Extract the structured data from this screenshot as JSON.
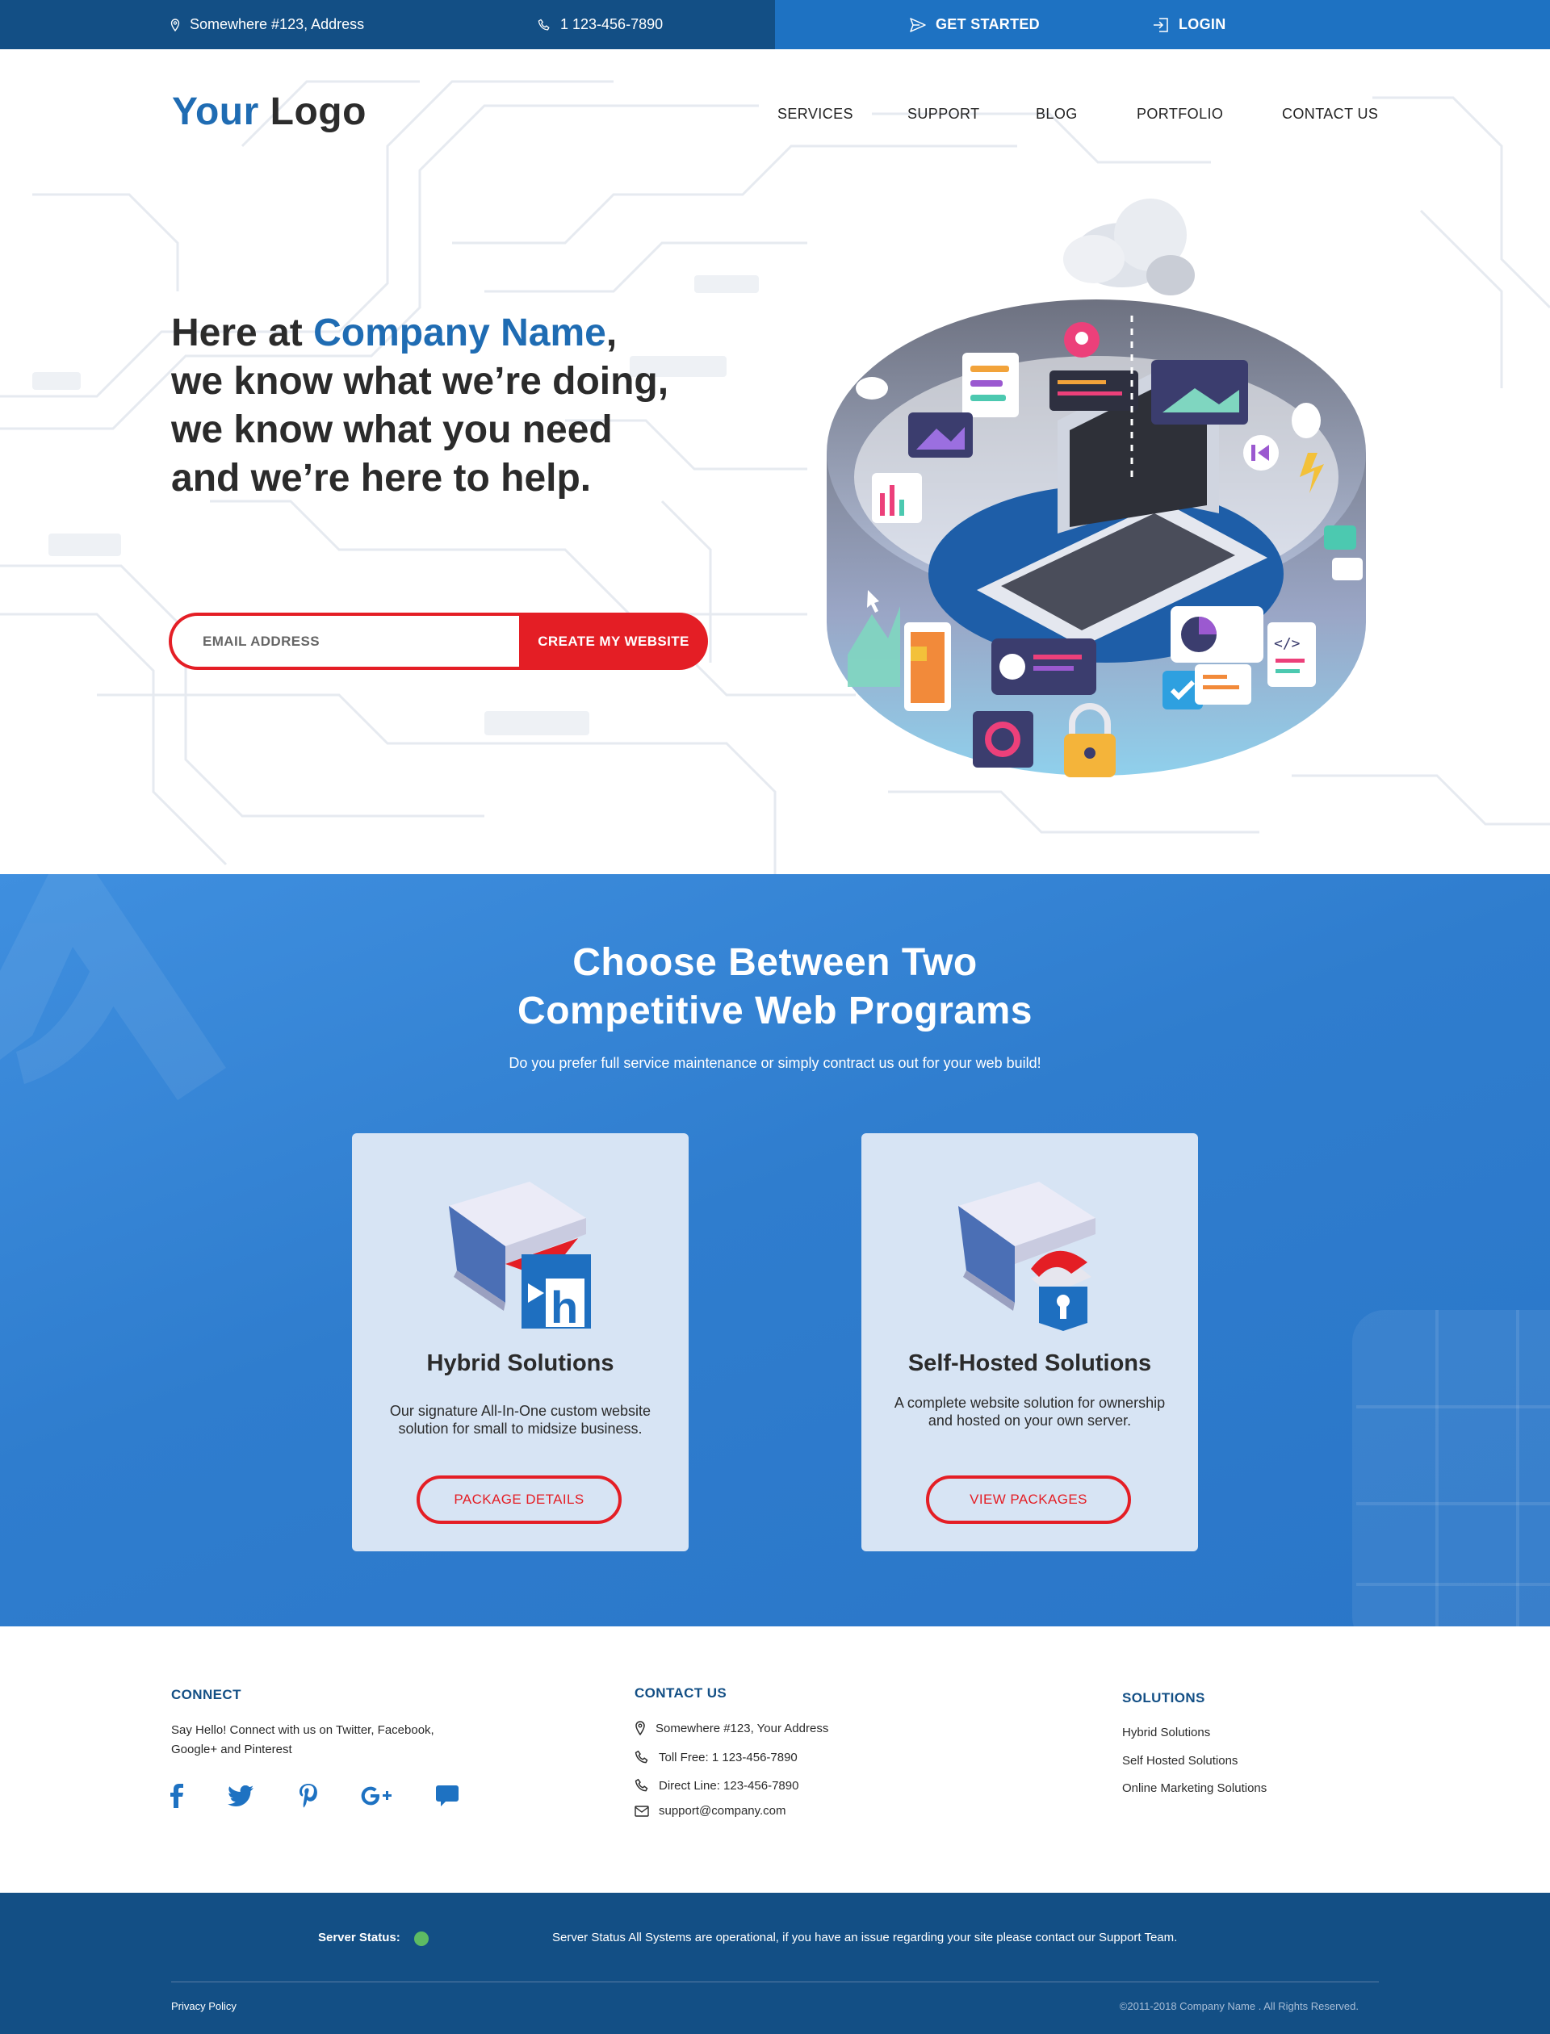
{
  "topbar": {
    "address": "Somewhere #123, Address",
    "phone": "1 123-456-7890",
    "get_started": "GET STARTED",
    "login": "LOGIN"
  },
  "header": {
    "logo_accent": "Your",
    "logo_rest": "Logo",
    "nav": [
      "SERVICES",
      "SUPPORT",
      "BLOG",
      "PORTFOLIO",
      "CONTACT US"
    ]
  },
  "hero": {
    "headline_prefix": "Here at ",
    "headline_company": "Company Name",
    "headline_comma": ",",
    "headline_line2": "we know what we’re doing,",
    "headline_line3": "we know what you need",
    "headline_line4": "and we’re here to help.",
    "email_placeholder": "EMAIL ADDRESS",
    "cta_label": "CREATE MY WEBSITE"
  },
  "programs": {
    "title_line1": "Choose Between Two",
    "title_line2": "Competitive Web Programs",
    "subtitle": "Do you prefer full service maintenance or simply contract us out for your web build!",
    "cards": [
      {
        "title": "Hybrid Solutions",
        "desc_line1": "Our signature All-In-One custom website",
        "desc_line2": "solution for small to midsize business.",
        "button": "PACKAGE DETAILS"
      },
      {
        "title": "Self-Hosted Solutions",
        "desc_line1": "A complete website solution for ownership",
        "desc_line2": "and hosted on your own server.",
        "button": "VIEW PACKAGES"
      }
    ]
  },
  "footer": {
    "connect": {
      "heading": "CONNECT",
      "text_line1": "Say Hello! Connect with us on Twitter, Facebook,",
      "text_line2": "Google+ and Pinterest",
      "social": [
        "facebook-icon",
        "twitter-icon",
        "pinterest-icon",
        "google-plus-icon",
        "chat-icon"
      ]
    },
    "contact": {
      "heading": "CONTACT US",
      "address": "Somewhere #123, Your Address",
      "toll_free": "Toll Free: 1 123-456-7890",
      "direct": "Direct Line: 123-456-7890",
      "email": "support@company.com"
    },
    "solutions": {
      "heading": "SOLUTIONS",
      "links": [
        "Hybrid Solutions",
        "Self Hosted Solutions",
        "Online Marketing Solutions"
      ]
    }
  },
  "bottom": {
    "status_label": "Server Status:",
    "status_text": "Server Status All Systems are operational, if you have an issue regarding your site please contact our Support Team.",
    "privacy": "Privacy Policy",
    "copyright": "©2011-2018 Company Name . All Rights Reserved."
  },
  "colors": {
    "brand_dark": "#134f85",
    "brand_blue": "#1e72c2",
    "accent_red": "#e41e25",
    "status_green": "#5dbb63"
  }
}
